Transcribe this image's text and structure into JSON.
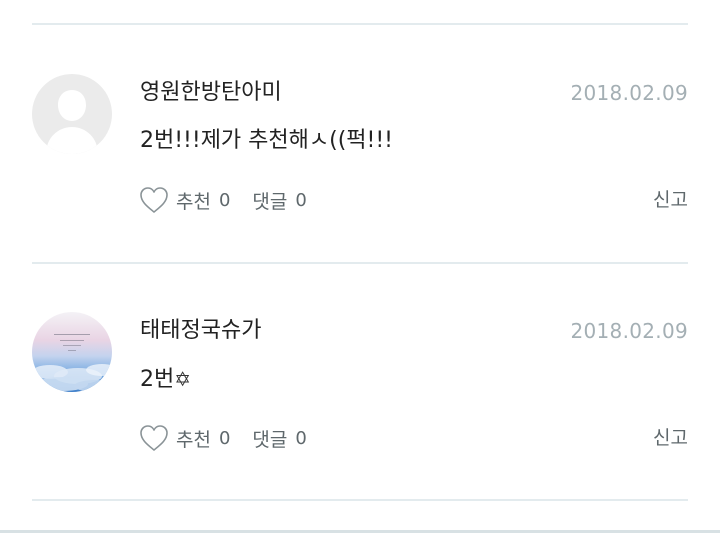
{
  "comments": [
    {
      "username": "영원한방탄아미",
      "date": "2018.02.09",
      "body": "2번!!!제가 추천해ㅅ((퍽!!!",
      "body_suffix": "",
      "avatar_type": "default-person",
      "like_label": "추천",
      "like_count": "0",
      "reply_label": "댓글",
      "reply_count": "0",
      "report_label": "신고"
    },
    {
      "username": "태태정국슈가",
      "date": "2018.02.09",
      "body": "2번",
      "body_suffix": "✡",
      "avatar_type": "sky-clouds-photo",
      "like_label": "추천",
      "like_count": "0",
      "reply_label": "댓글",
      "reply_count": "0",
      "report_label": "신고"
    }
  ],
  "icons": {
    "like": "heart-outline-icon"
  },
  "colors": {
    "divider": "#e3ebee",
    "date_text": "#a4afb4",
    "action_text": "#5f686c",
    "avatar_placeholder": "#ebebeb"
  }
}
